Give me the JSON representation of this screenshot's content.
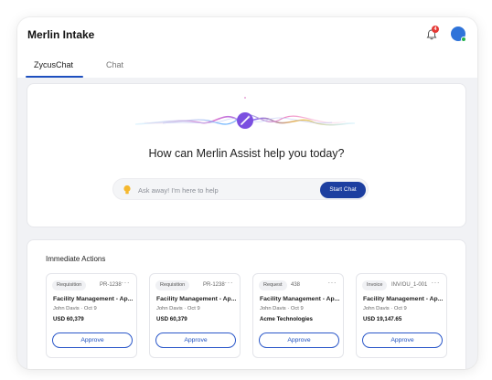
{
  "app": {
    "title": "Merlin Intake"
  },
  "header": {
    "notification_count": "4"
  },
  "tabs": [
    {
      "label": "ZycusChat",
      "active": true
    },
    {
      "label": "Chat",
      "active": false
    }
  ],
  "hero": {
    "title": "How can Merlin Assist help you today?",
    "input_placeholder": "Ask away! I'm here to help",
    "start_label": "Start Chat"
  },
  "actions": {
    "title": "Immediate Actions",
    "cards": [
      {
        "type": "Requisition",
        "id": "PR-1238",
        "title": "Facility Management - Ap...",
        "meta": "John Davis · Oct 9",
        "amount": "USD 60,379",
        "approve_label": "Approve"
      },
      {
        "type": "Requisition",
        "id": "PR-1238",
        "title": "Facility Management - Ap...",
        "meta": "John Davis · Oct 9",
        "amount": "USD 60,379",
        "approve_label": "Approve"
      },
      {
        "type": "Request",
        "id": "438",
        "title": "Facility Management - Ap...",
        "meta": "John Davis · Oct 9",
        "amount": "Acme Technologies",
        "approve_label": "Approve"
      },
      {
        "type": "Invoice",
        "id": "INV/OU_1-001",
        "title": "Facility Management - Ap...",
        "meta": "John Davis · Oct 9",
        "amount": "USD 19,147.65",
        "approve_label": "Approve"
      }
    ]
  },
  "colors": {
    "accent": "#1d4fbf",
    "button_dark": "#1d3fa0",
    "badge": "#e53935",
    "avatar": "#2f73d9",
    "online": "#24b24b"
  },
  "icons": {
    "notifications": "bell-icon",
    "assistant": "magic-wand-icon",
    "hint": "lightbulb-icon",
    "more": "ellipsis-icon"
  }
}
